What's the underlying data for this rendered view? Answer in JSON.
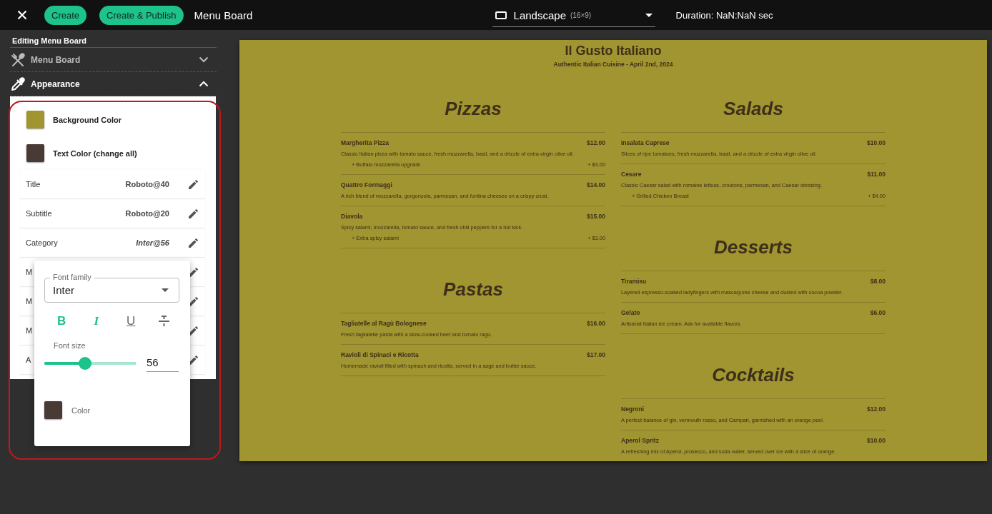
{
  "topbar": {
    "buttons": [
      "Create",
      "Create & Publish"
    ],
    "title": "Menu Board",
    "orientation": {
      "label": "Landscape",
      "hint": "(16×9)"
    },
    "duration": "Duration: NaN:NaN sec"
  },
  "sidebar": {
    "heading": "Editing Menu Board",
    "sections": [
      {
        "label": "Menu Board",
        "kind": "utensils",
        "expanded": false
      },
      {
        "label": "Appearance",
        "kind": "pipette",
        "expanded": true
      }
    ],
    "colors": [
      {
        "label": "Background Color",
        "color": "#a09530"
      },
      {
        "label": "Text Color (change all)",
        "color": "#4a3a36"
      }
    ],
    "font_rows": [
      {
        "label": "Title",
        "value": "Roboto@40",
        "italic": false
      },
      {
        "label": "Subtitle",
        "value": "Roboto@20",
        "italic": false
      },
      {
        "label": "Category",
        "value": "Inter@56",
        "italic": true
      },
      {
        "label": "M"
      },
      {
        "label": "M"
      },
      {
        "label": "M"
      },
      {
        "label": "A"
      }
    ]
  },
  "popup": {
    "font_family": {
      "label": "Font family",
      "value": "Inter"
    },
    "format": [
      {
        "kind": "bold",
        "symbol": "B",
        "selected": true
      },
      {
        "kind": "italic",
        "symbol": "I",
        "selected": true
      },
      {
        "kind": "underline",
        "symbol": "U",
        "selected": false
      },
      {
        "kind": "strikethrough",
        "selected": false
      }
    ],
    "font_size": {
      "label": "Font size",
      "level": 0.44,
      "value": "56"
    },
    "color": {
      "label": "Color",
      "color": "#4a3a36"
    }
  },
  "menu": {
    "title": "Il Gusto Italiano",
    "subtitle": "Authentic Italian Cuisine - April 2nd, 2024",
    "columns": [
      {
        "sections": [
          {
            "heading": "Pizzas",
            "items": [
              {
                "name": "Margherita Pizza",
                "price": "$12.00",
                "description": "Classic Italian pizza with tomato sauce, fresh mozzarella, basil, and a drizzle of extra-virgin olive oil.",
                "addons": [
                  {
                    "label": "+ Buffalo mozzarella upgrade",
                    "price": "+ $3.00"
                  }
                ]
              },
              {
                "name": "Quattro Formaggi",
                "price": "$14.00",
                "description": "A rich blend of mozzarella, gorgonzola, parmesan, and fontina cheeses on a crispy crust."
              },
              {
                "name": "Diavola",
                "price": "$15.00",
                "description": "Spicy salami, mozzarella, tomato sauce, and fresh chili peppers for a hot kick.",
                "addons": [
                  {
                    "label": "+ Extra spicy salami",
                    "price": "+ $3.00"
                  }
                ]
              }
            ]
          },
          {
            "heading": "Pastas",
            "items": [
              {
                "name": "Tagliatelle al Ragù Bolognese",
                "price": "$16.00",
                "description": "Fresh tagliatelle pasta with a slow-cooked beef and tomato ragù."
              },
              {
                "name": "Ravioli di Spinaci e Ricotta",
                "price": "$17.00",
                "description": "Homemade ravioli filled with spinach and ricotta, served in a sage and butter sauce."
              }
            ]
          }
        ]
      },
      {
        "sections": [
          {
            "heading": "Salads",
            "items": [
              {
                "name": "Insalata Caprese",
                "price": "$10.00",
                "description": "Slices of ripe tomatoes, fresh mozzarella, basil, and a drizzle of extra virgin olive oil."
              },
              {
                "name": "Cesare",
                "price": "$11.00",
                "description": "Classic Caesar salad with romaine lettuce, croutons, parmesan, and Caesar dressing.",
                "addons": [
                  {
                    "label": "+ Grilled Chicken Breast",
                    "price": "+ $4.00"
                  }
                ]
              }
            ]
          },
          {
            "heading": "Desserts",
            "items": [
              {
                "name": "Tiramisu",
                "price": "$8.00",
                "description": "Layered espresso-soaked ladyfingers with mascarpone cheese and dusted with cocoa powder."
              },
              {
                "name": "Gelato",
                "price": "$6.00",
                "description": "Artisanal Italian ice cream. Ask for available flavors."
              }
            ]
          },
          {
            "heading": "Cocktails",
            "items": [
              {
                "name": "Negroni",
                "price": "$12.00",
                "description": "A perfect balance of gin, vermouth rosso, and Campari, garnished with an orange peel."
              },
              {
                "name": "Aperol Spritz",
                "price": "$10.00",
                "description": "A refreshing mix of Aperol, prosecco, and soda water, served over ice with a slice of orange."
              }
            ]
          }
        ]
      }
    ]
  }
}
